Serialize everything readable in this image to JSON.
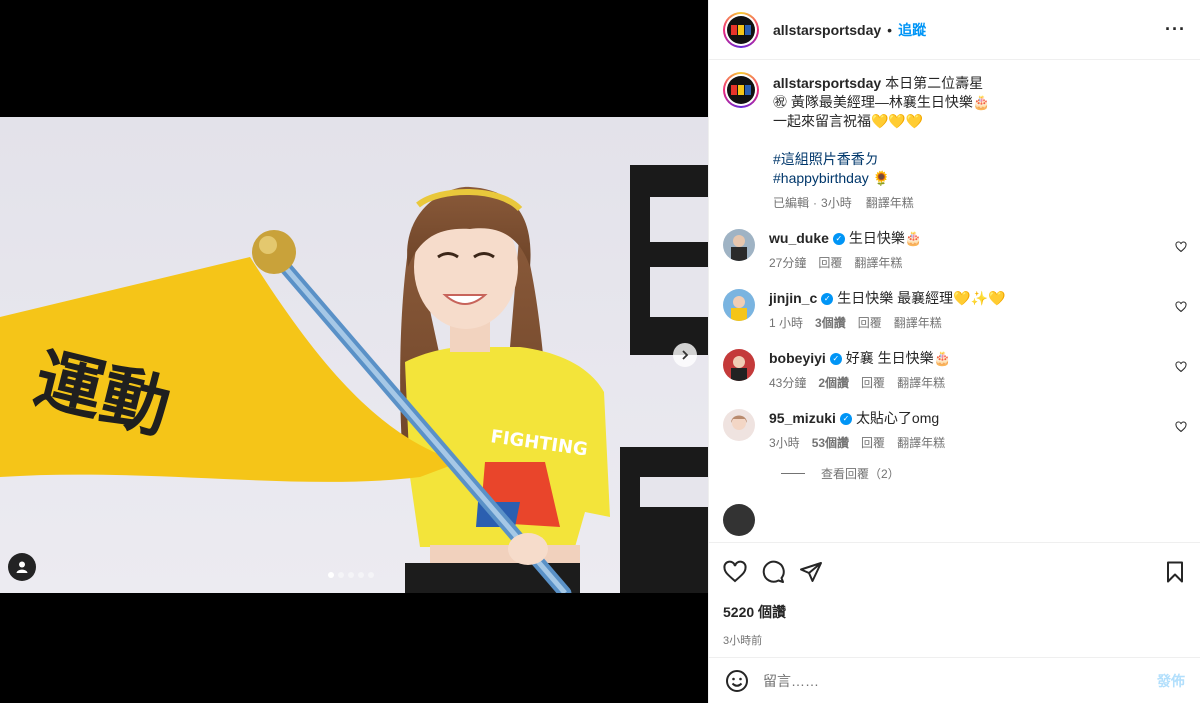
{
  "header": {
    "username": "allstarsportsday",
    "separator": "•",
    "follow_label": "追蹤",
    "more_label": "···"
  },
  "caption": {
    "username": "allstarsportsday",
    "line1": "本日第二位壽星",
    "line2": "㊗ 黃隊最美經理—林襄生日快樂🎂",
    "line3": "一起來留言祝福💛💛💛",
    "hashtag1": "#這組照片香香ㄉ",
    "hashtag2": "#happybirthday 🌻",
    "edited": "已編輯",
    "dot": "·",
    "time": "3小時",
    "translate": "翻譯年糕"
  },
  "comments": [
    {
      "username": "wu_duke",
      "verified": true,
      "text": "生日快樂🎂",
      "time": "27分鐘",
      "likes": "",
      "reply": "回覆",
      "translate": "翻譯年糕"
    },
    {
      "username": "jinjin_c",
      "verified": true,
      "text": "生日快樂 最襄經理💛✨💛",
      "time": "1 小時",
      "likes": "3個讚",
      "reply": "回覆",
      "translate": "翻譯年糕"
    },
    {
      "username": "bobeyiyi",
      "verified": true,
      "text": "好襄 生日快樂🎂",
      "time": "43分鐘",
      "likes": "2個讚",
      "reply": "回覆",
      "translate": "翻譯年糕"
    },
    {
      "username": "95_mizuki",
      "verified": true,
      "text": "太貼心了omg",
      "time": "3小時",
      "likes": "53個讚",
      "reply": "回覆",
      "translate": "翻譯年糕"
    }
  ],
  "view_replies": "查看回覆（2）",
  "likes_count": "5220 個讚",
  "post_time": "3小時前",
  "comment_input": {
    "placeholder": "留言……"
  },
  "post_button": "發佈",
  "photo": {
    "banner_text": "運動",
    "shirt_text": "FIGHTING",
    "flag_color": "#f5c518",
    "shirt_color": "#f3e43a"
  },
  "colors": {
    "accent": "#0095f6",
    "link": "#00376b",
    "muted": "#737373"
  }
}
